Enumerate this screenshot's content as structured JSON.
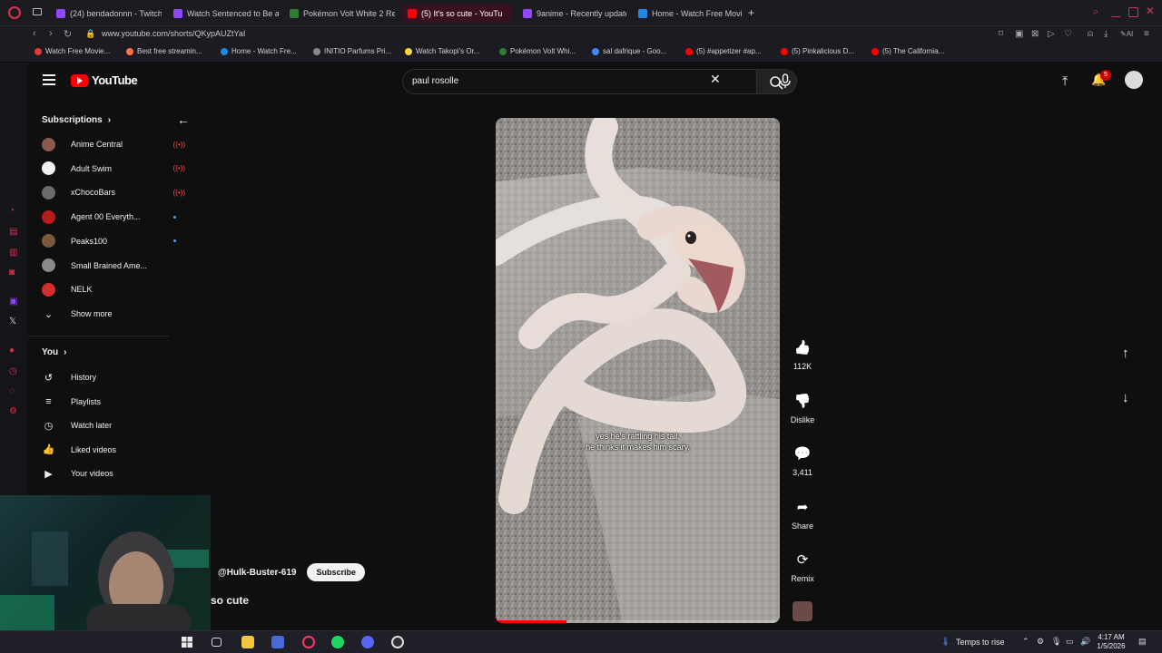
{
  "browser": {
    "tabs": [
      {
        "label": "(24) bendadonnn - Twitch",
        "color": "#9146ff",
        "active": false
      },
      {
        "label": "Watch Sentenced to Be a",
        "color": "#9146ff",
        "active": false
      },
      {
        "label": "Pokémon Volt White 2 Re",
        "color": "#2e7d32",
        "active": false
      },
      {
        "label": "(5) It's so cute - YouTu",
        "color": "#ff0000",
        "active": true
      },
      {
        "label": "9anime - Recently update",
        "color": "#9146ff",
        "active": false
      },
      {
        "label": "Home - Watch Free Movie",
        "color": "#1e88e5",
        "active": false
      }
    ],
    "new_tab": "+",
    "url": "www.youtube.com/shorts/QKypAUZtYaI",
    "bookmarks": [
      {
        "label": "Watch Free Movie...",
        "color": "#e53935"
      },
      {
        "label": "Best free streamin...",
        "color": "#ff7043"
      },
      {
        "label": "Home - Watch Fre...",
        "color": "#1e88e5"
      },
      {
        "label": "INITIO Parfums Pri...",
        "color": "#888888"
      },
      {
        "label": "Watch Takopi's Or...",
        "color": "#fdd835"
      },
      {
        "label": "Pokémon Volt Whi...",
        "color": "#2e7d32"
      },
      {
        "label": "sal dafrique - Goo...",
        "color": "#4285f4"
      },
      {
        "label": "(5) #appetizer #ap...",
        "color": "#ff0000"
      },
      {
        "label": "(5) Pinkalicious D...",
        "color": "#ff0000"
      },
      {
        "label": "(5) The California...",
        "color": "#ff0000"
      }
    ]
  },
  "header": {
    "logo": "YouTube",
    "search_value": "paul rosolle",
    "notifications": "5"
  },
  "guide": {
    "subscriptions_label": "Subscriptions",
    "subscriptions": [
      {
        "label": "Anime Central",
        "color": "#8b5a4a",
        "status": "live"
      },
      {
        "label": "Adult Swim",
        "color": "#f1f1f1",
        "status": "live"
      },
      {
        "label": "xChocoBars",
        "color": "#6b6b6b",
        "status": "live"
      },
      {
        "label": "Agent 00 Everyth...",
        "color": "#b71c1c",
        "status": "new"
      },
      {
        "label": "Peaks100",
        "color": "#7a5a3a",
        "status": "new"
      },
      {
        "label": "Small Brained Ame...",
        "color": "#8a8a8a",
        "status": "none"
      },
      {
        "label": "NELK",
        "color": "#d32f2f",
        "status": "none"
      }
    ],
    "show_more": "Show more",
    "you_label": "You",
    "you_items": [
      {
        "label": "History",
        "icon": "history-icon",
        "glyph": "↺"
      },
      {
        "label": "Playlists",
        "icon": "playlists-icon",
        "glyph": "≡"
      },
      {
        "label": "Watch later",
        "icon": "clock-icon",
        "glyph": "◷"
      },
      {
        "label": "Liked videos",
        "icon": "thumbs-up-icon",
        "glyph": "👍"
      },
      {
        "label": "Your videos",
        "icon": "video-icon",
        "glyph": "▶"
      }
    ]
  },
  "short": {
    "caption_line1": "yes he's rattling his tail.",
    "caption_line2": "he thinks it makes him scary.",
    "progress": 0.25,
    "channel": "@Hulk-Buster-619",
    "subscribe": "Subscribe",
    "title": "so cute"
  },
  "actions": [
    {
      "icon": "thumbs-up-icon",
      "glyph": "👍",
      "label": "112K"
    },
    {
      "icon": "thumbs-down-icon",
      "glyph": "👎",
      "label": "Dislike"
    },
    {
      "icon": "comment-icon",
      "glyph": "💬",
      "label": "3,411"
    },
    {
      "icon": "share-icon",
      "glyph": "➦",
      "label": "Share"
    },
    {
      "icon": "remix-icon",
      "glyph": "⟳",
      "label": "Remix"
    }
  ],
  "taskbar": {
    "weather": "Temps to rise",
    "time": "4:17 AM",
    "date": "1/5/2026"
  },
  "colors": {
    "accent": "#ff0000",
    "background": "#0f0f0f",
    "opera": "#d8334e"
  }
}
